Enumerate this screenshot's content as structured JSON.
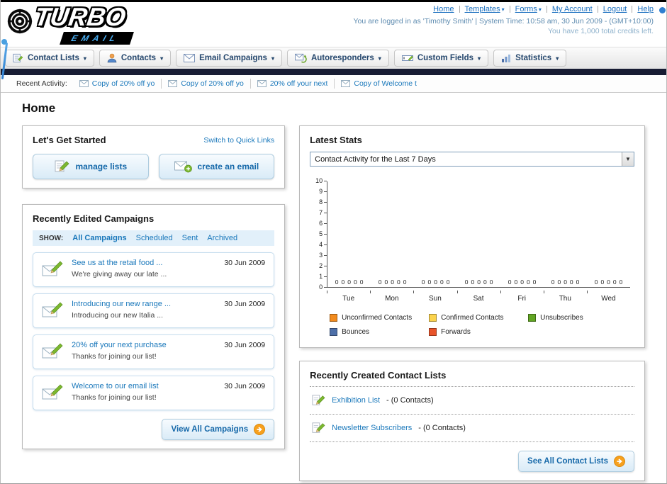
{
  "colors": {
    "link_blue": "#1a78bb",
    "navbar_dark": "#171c33",
    "button_text_blue": "#1568a9",
    "arrow_orange": "#f7a01d"
  },
  "header": {
    "logo": {
      "title": "TURBO",
      "subtitle": "EMAIL"
    },
    "links": [
      "Home",
      "Templates",
      "Forms",
      "My Account",
      "Logout",
      "Help"
    ],
    "session_line": "You are logged in as 'Timothy Smith' | System Time: 10:58 am, 30 Jun 2009 - (GMT+10:00)",
    "credits_line": "You have 1,000 total credits left."
  },
  "nav": {
    "tabs": [
      "Contact Lists",
      "Contacts",
      "Email Campaigns",
      "Autoresponders",
      "Custom Fields",
      "Statistics"
    ]
  },
  "recent_activity": {
    "label": "Recent Activity:",
    "items": [
      "Copy of 20% off yo",
      "Copy of 20% off yo",
      "20% off your next",
      "Copy of Welcome t"
    ]
  },
  "page": {
    "title": "Home"
  },
  "get_started": {
    "title": "Let's Get Started",
    "switch_link": "Switch to Quick Links",
    "manage_lists_label": "manage lists",
    "create_email_label": "create an email"
  },
  "campaigns": {
    "title": "Recently Edited Campaigns",
    "show_label": "SHOW:",
    "filters": [
      "All Campaigns",
      "Scheduled",
      "Sent",
      "Archived"
    ],
    "items": [
      {
        "title": "See us at the retail food ...",
        "subtitle": "We're giving away our late ...",
        "date": "30 Jun 2009"
      },
      {
        "title": "Introducing our new range ...",
        "subtitle": "Introducing our new Italia ...",
        "date": "30 Jun 2009"
      },
      {
        "title": "20% off your next purchase",
        "subtitle": "Thanks for joining our list!",
        "date": "30 Jun 2009"
      },
      {
        "title": "Welcome to our email list",
        "subtitle": "Thanks for joining our list!",
        "date": "30 Jun 2009"
      }
    ],
    "view_all_label": "View All Campaigns"
  },
  "stats": {
    "title": "Latest Stats",
    "period_selector": "Contact Activity for the Last 7 Days",
    "chart_data": {
      "type": "bar",
      "title": "Contact Activity for the Last 7 Days",
      "categories": [
        "Tue",
        "Mon",
        "Sun",
        "Sat",
        "Fri",
        "Thu",
        "Wed"
      ],
      "series": [
        {
          "name": "Unconfirmed Contacts",
          "color": "#f28b1e",
          "values": [
            0,
            0,
            0,
            0,
            0,
            0,
            0
          ]
        },
        {
          "name": "Confirmed Contacts",
          "color": "#fbd34d",
          "values": [
            0,
            0,
            0,
            0,
            0,
            0,
            0
          ]
        },
        {
          "name": "Unsubscribes",
          "color": "#61a523",
          "values": [
            0,
            0,
            0,
            0,
            0,
            0,
            0
          ]
        },
        {
          "name": "Bounces",
          "color": "#4d6fa8",
          "values": [
            0,
            0,
            0,
            0,
            0,
            0,
            0
          ]
        },
        {
          "name": "Forwards",
          "color": "#e8542a",
          "values": [
            0,
            0,
            0,
            0,
            0,
            0,
            0
          ]
        }
      ],
      "ylim": [
        0,
        10
      ],
      "ytick_step": 1,
      "grid": false,
      "legend_position": "bottom"
    }
  },
  "contact_lists": {
    "title": "Recently Created Contact Lists",
    "items": [
      {
        "name": "Exhibition List",
        "detail": "- (0 Contacts)"
      },
      {
        "name": "Newsletter Subscribers",
        "detail": "- (0 Contacts)"
      }
    ],
    "see_all_label": "See All Contact Lists"
  }
}
